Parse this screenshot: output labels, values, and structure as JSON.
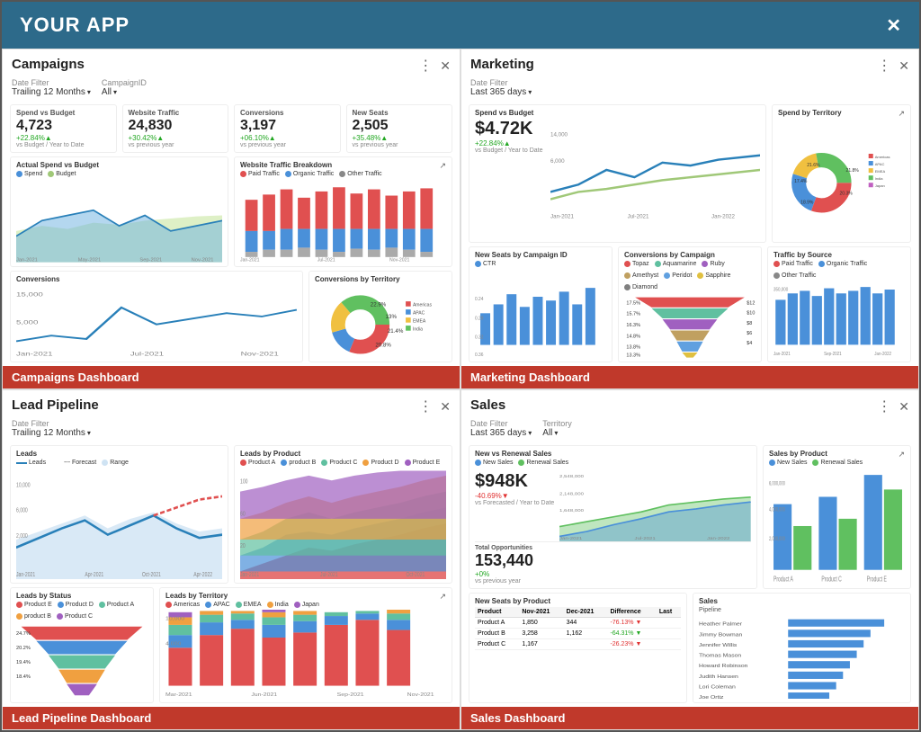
{
  "app": {
    "title": "YOUR APP",
    "close_label": "✕"
  },
  "panels": {
    "campaigns": {
      "title": "Campaigns",
      "filter_label": "Date Filter",
      "filter_value": "Trailing 12 Months",
      "filter2_label": "CampaignID",
      "filter2_value": "All",
      "banner_label": "Campaigns Dashboard",
      "metrics": [
        {
          "title": "Spend vs Budget",
          "value": "4,723",
          "change": "+22.84%▲",
          "sub": "vs Budget / Year to Date",
          "positive": true
        },
        {
          "title": "Website Traffic",
          "value": "24,830",
          "change": "+30.42%▲",
          "sub": "vs previous year",
          "positive": true
        },
        {
          "title": "Conversions",
          "value": "3,197",
          "change": "+06.10%▲",
          "sub": "vs previous year",
          "positive": true
        },
        {
          "title": "New Seats",
          "value": "2,505",
          "change": "+35.48%▲",
          "sub": "vs previous year",
          "positive": true
        }
      ]
    },
    "marketing": {
      "title": "Marketing",
      "filter_label": "Date Filter",
      "filter_value": "Last 365 days",
      "banner_label": "Marketing Dashboard",
      "big_metric_value": "$4.72K",
      "big_metric_change": "+22.84%▲",
      "big_metric_sub": "vs Budget / Year to Date"
    },
    "lead_pipeline": {
      "title": "Lead Pipeline",
      "filter_label": "Date Filter",
      "filter_value": "Trailing 12 Months",
      "banner_label": "Lead Pipeline Dashboard"
    },
    "sales": {
      "title": "Sales",
      "filter_label": "Date Filter",
      "filter_value": "Last 365 days",
      "filter2_label": "Territory",
      "filter2_value": "All",
      "banner_label": "Sales Dashboard",
      "big_metric_value": "$948K",
      "big_metric_change": "-40.69%▼",
      "big_metric_sub": "vs Forecasted / Year to Date",
      "total_opp_label": "Total Opportunities",
      "total_opp_value": "153,440",
      "total_opp_change": "+0%",
      "total_opp_sub": "vs previous year",
      "table": {
        "headers": [
          "Product",
          "Nov-2021",
          "Dec-2021",
          "Difference",
          "Last"
        ],
        "rows": [
          [
            "Product A",
            "1,850",
            "344",
            "-76.13%▼",
            ""
          ],
          [
            "Product B",
            "3,258",
            "1,162",
            "-64.31%▼",
            ""
          ],
          [
            "Product C",
            "1,167",
            "",
            "-26.23%▼",
            ""
          ]
        ]
      }
    }
  }
}
